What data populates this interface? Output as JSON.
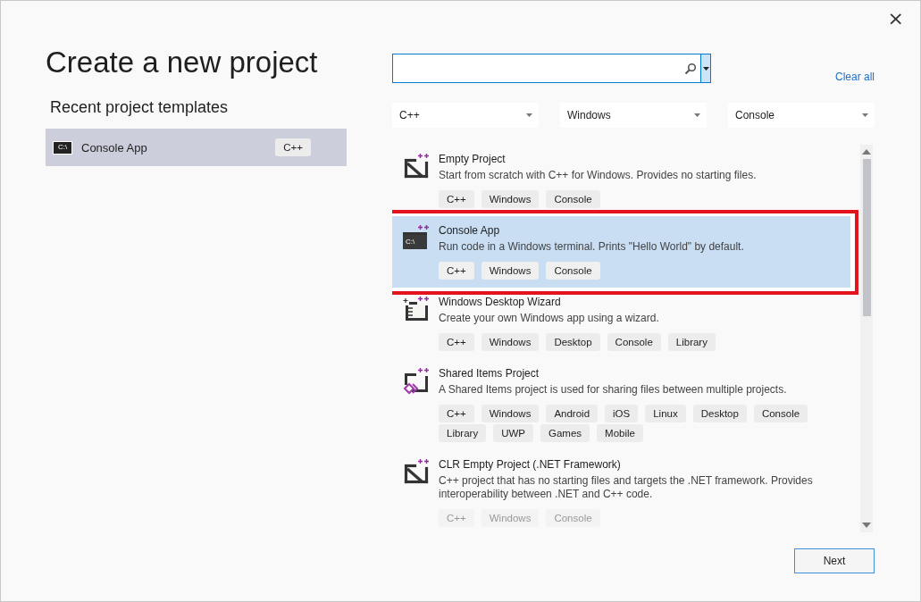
{
  "dialog": {
    "title": "Create a new project",
    "close": "×"
  },
  "recent": {
    "heading": "Recent project templates",
    "items": [
      {
        "name": "Console App",
        "icon_label": "C:\\",
        "tag": "C++",
        "selected": true
      }
    ]
  },
  "clear_all": "Clear all",
  "filters": [
    {
      "value": "C++"
    },
    {
      "value": "Windows"
    },
    {
      "value": "Console"
    }
  ],
  "templates": [
    {
      "kind": "empty",
      "name": "Empty Project",
      "description": "Start from scratch with C++ for Windows. Provides no starting files.",
      "tags": [
        "C++",
        "Windows",
        "Console"
      ],
      "selected": false,
      "annotated": false,
      "faded": false
    },
    {
      "kind": "console",
      "icon_label": "C:\\",
      "name": "Console App",
      "description": "Run code in a Windows terminal. Prints \"Hello World\" by default.",
      "tags": [
        "C++",
        "Windows",
        "Console"
      ],
      "selected": true,
      "annotated": true,
      "faded": false
    },
    {
      "kind": "wizard",
      "name": "Windows Desktop Wizard",
      "description": "Create your own Windows app using a wizard.",
      "tags": [
        "C++",
        "Windows",
        "Desktop",
        "Console",
        "Library"
      ],
      "selected": false,
      "annotated": false,
      "faded": false
    },
    {
      "kind": "shared",
      "name": "Shared Items Project",
      "description": "A Shared Items project is used for sharing files between multiple projects.",
      "tags": [
        "C++",
        "Windows",
        "Android",
        "iOS",
        "Linux",
        "Desktop",
        "Console",
        "Library",
        "UWP",
        "Games",
        "Mobile"
      ],
      "selected": false,
      "annotated": false,
      "faded": false
    },
    {
      "kind": "empty",
      "name": "CLR Empty Project (.NET Framework)",
      "description": "C++ project that has no starting files and targets the .NET framework. Provides interoperability between .NET and C++ code.",
      "tags": [
        "C++",
        "Windows",
        "Console"
      ],
      "selected": false,
      "annotated": false,
      "faded": true
    }
  ],
  "next_button": "Next"
}
